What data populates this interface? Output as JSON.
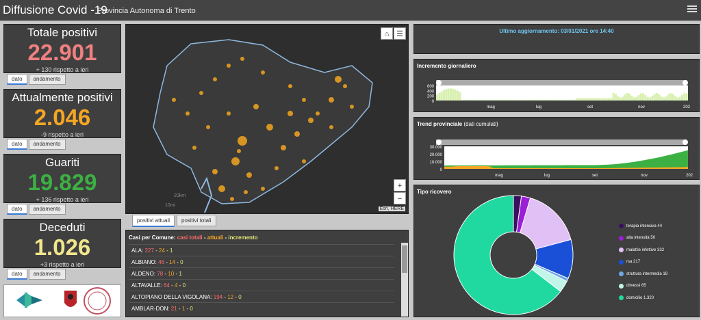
{
  "header": {
    "title": "Diffusione Covid -19",
    "subtitle": "Provincia Autonoma di Trento"
  },
  "stats": [
    {
      "title": "Totale positivi",
      "value": "22.901",
      "delta": "+ 130 rispetto a ieri",
      "color": "#f08080",
      "tabs": [
        "dato",
        "andamento"
      ]
    },
    {
      "title": "Attualmente positivi",
      "value": "2.046",
      "delta": "-9 rispetto a ieri",
      "color": "#f5a623",
      "tabs": [
        "dato",
        "andamento"
      ]
    },
    {
      "title": "Guariti",
      "value": "19.829",
      "delta": "+ 136 rispetto a ieri",
      "color": "#3cb043",
      "tabs": [
        "dato",
        "andamento"
      ]
    },
    {
      "title": "Deceduti",
      "value": "1.026",
      "delta": "+3 rispetto a ieri",
      "color": "#f0e68c",
      "tabs": [
        "dato",
        "andamento"
      ]
    }
  ],
  "map": {
    "attribution": "Esri, HERE",
    "tabs": [
      "positivi attuali",
      "positivi totali"
    ],
    "scale_label": "10mi",
    "scale_label2": "20km"
  },
  "comuni": {
    "header_prefix": "Casi per Comune: ",
    "header_tot": "casi totali",
    "header_sep1": " - ",
    "header_att": "attuali",
    "header_sep2": " - ",
    "header_inc": "incremento",
    "rows": [
      {
        "name": "ALA: ",
        "tot": "227",
        "att": "24",
        "inc": "1"
      },
      {
        "name": "ALBIANO: ",
        "tot": "46",
        "att": "14",
        "inc": "0"
      },
      {
        "name": "ALDENO: ",
        "tot": "78",
        "att": "10",
        "inc": "1"
      },
      {
        "name": "ALTAVALLE: ",
        "tot": "64",
        "att": "4",
        "inc": "0"
      },
      {
        "name": "ALTOPIANO DELLA VIGOLANA: ",
        "tot": "194",
        "att": "12",
        "inc": "0"
      },
      {
        "name": "AMBLAR-DON: ",
        "tot": "21",
        "att": "1",
        "inc": "0"
      }
    ]
  },
  "updated": "Ultimo aggiornamento: 03/01/2021 ore 14:40",
  "chart_data": [
    {
      "type": "bar",
      "title": "Incremento giornaliero",
      "subtitle": "",
      "yticks": [
        "600",
        "400",
        "200",
        "0"
      ],
      "ylim": [
        0,
        600
      ],
      "xticks": [
        "mag",
        "lug",
        "set",
        "nov",
        "202"
      ],
      "color": "#d8f0b0"
    },
    {
      "type": "area",
      "title": "Trend provinciale",
      "subtitle": "(dati cumulati)",
      "yticks": [
        "30.000",
        "20.000",
        "10.000",
        "0"
      ],
      "ylim": [
        0,
        30000
      ],
      "xticks": [
        "mag",
        "lug",
        "set",
        "nov",
        "202"
      ],
      "series": [
        {
          "name": "",
          "color": "#3cb043"
        },
        {
          "name": "",
          "color": "#f5a623"
        }
      ]
    },
    {
      "type": "pie",
      "title": "Tipo ricovero",
      "slices": [
        {
          "label": "terapia intensiva",
          "value": 44,
          "color": "#3b0f5e"
        },
        {
          "label": "alta intensità",
          "value": 50,
          "color": "#9b1fd6"
        },
        {
          "label": "malattie infettive",
          "value": 332,
          "color": "#e0c0f5"
        },
        {
          "label": "rsa",
          "value": 217,
          "color": "#1a4fd8"
        },
        {
          "label": "struttura intermedia",
          "value": 18,
          "color": "#6fa8e8"
        },
        {
          "label": "dimessi",
          "value": 65,
          "color": "#c0f5e8"
        },
        {
          "label": "domicilio",
          "value": 1320,
          "color": "#20d9a0"
        }
      ]
    }
  ]
}
